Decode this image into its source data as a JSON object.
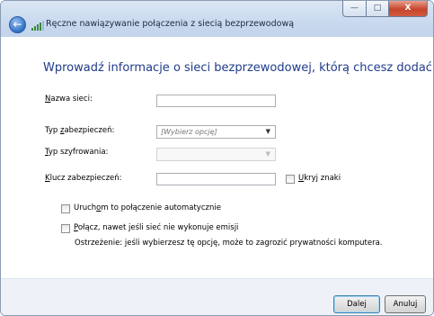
{
  "window": {
    "title": "Ręczne nawiązywanie połączenia z siecią bezprzewodową",
    "controls": {
      "minimize": "—",
      "maximize": "□",
      "close": "X"
    },
    "back_icon": "back-arrow-icon",
    "network_icon": "wireless-signal-icon"
  },
  "heading": "Wprowadź informacje o sieci bezprzewodowej, którą chcesz dodać.",
  "form": {
    "network_name": {
      "label_mnemonic": "N",
      "label_rest": "azwa sieci:",
      "value": ""
    },
    "security_type": {
      "label_before": "Typ ",
      "label_mnemonic": "z",
      "label_after": "abezpieczeń:",
      "selected": "[Wybierz opcję]"
    },
    "encryption_type": {
      "label_mnemonic": "T",
      "label_rest": "yp szyfrowania:",
      "selected": ""
    },
    "security_key": {
      "label_mnemonic": "K",
      "label_rest": "lucz zabezpieczeń:",
      "value": "",
      "hide_chars": {
        "label_mnemonic": "U",
        "label_rest": "kryj znaki",
        "checked": false
      }
    },
    "auto_connect": {
      "label_before": "Uruch",
      "label_mnemonic": "o",
      "label_after": "m to połączenie automatycznie",
      "checked": false
    },
    "connect_hidden": {
      "label_mnemonic": "P",
      "label_rest": "ołącz, nawet jeśli sieć nie wykonuje emisji",
      "checked": false,
      "warning": "Ostrzeżenie: jeśli wybierzesz tę opcję, może to zagrozić prywatności komputera."
    }
  },
  "buttons": {
    "next": "Dalej",
    "cancel": "Anuluj"
  },
  "colors": {
    "heading": "#1f3c8a",
    "titlebar": "#c9d9ee",
    "footer": "#eef2f8",
    "close_button": "#c7452b"
  }
}
